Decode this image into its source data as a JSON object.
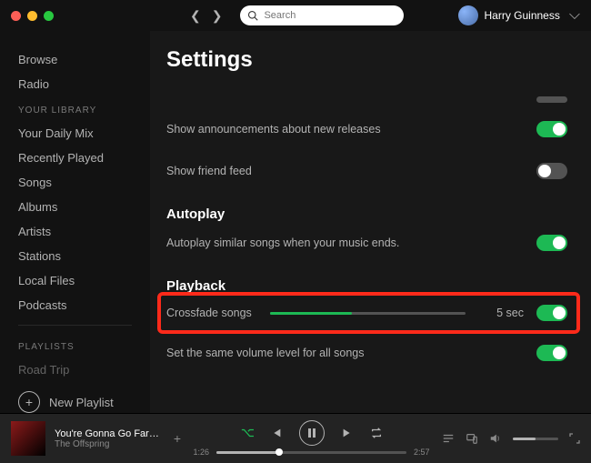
{
  "search": {
    "placeholder": "Search"
  },
  "user": {
    "name": "Harry Guinness"
  },
  "sidebar": {
    "main": [
      "Browse",
      "Radio"
    ],
    "library_header": "YOUR LIBRARY",
    "library": [
      "Your Daily Mix",
      "Recently Played",
      "Songs",
      "Albums",
      "Artists",
      "Stations",
      "Local Files",
      "Podcasts"
    ],
    "playlists_header": "PLAYLISTS",
    "playlists": [
      "Road Trip"
    ],
    "new_playlist": "New Playlist"
  },
  "page": {
    "title": "Settings",
    "announcements_label": "Show announcements about new releases",
    "friendfeed_label": "Show friend feed",
    "autoplay_header": "Autoplay",
    "autoplay_desc": "Autoplay similar songs when your music ends.",
    "playback_header": "Playback",
    "crossfade_label": "Crossfade songs",
    "crossfade_value": "5 sec",
    "normalize_label": "Set the same volume level for all songs",
    "toggles": {
      "announcements": true,
      "friendfeed": false,
      "autoplay": true,
      "crossfade": true,
      "normalize": true
    }
  },
  "player": {
    "track_title": "You're Gonna Go Far…",
    "artist": "The Offspring",
    "elapsed": "1:26",
    "duration": "2:57"
  }
}
